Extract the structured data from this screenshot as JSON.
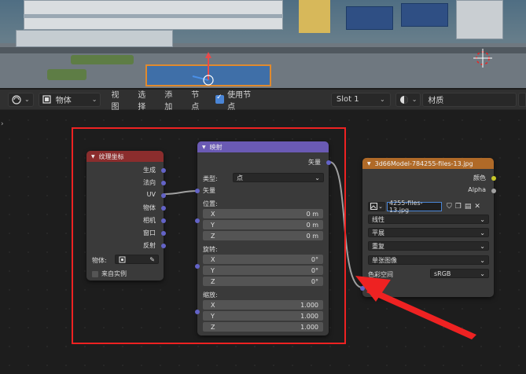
{
  "header": {
    "object_mode": "物体",
    "menus": [
      "视图",
      "选择",
      "添加",
      "节点"
    ],
    "use_nodes_label": "使用节点",
    "slot": "Slot 1",
    "material_name": "材质"
  },
  "texcoord_node": {
    "title": "纹理坐标",
    "outputs": [
      "生成",
      "法向",
      "UV",
      "物体",
      "相机",
      "窗口",
      "反射"
    ],
    "object_label": "物体:",
    "from_instancer": "来自实例"
  },
  "mapping_node": {
    "title": "映射",
    "output": "矢量",
    "type_label": "类型:",
    "type_value": "点",
    "vector_input": "矢量",
    "location": {
      "label": "位置:",
      "x": "0 m",
      "y": "0 m",
      "z": "0 m"
    },
    "rotation": {
      "label": "旋转:",
      "x": "0°",
      "y": "0°",
      "z": "0°"
    },
    "scale": {
      "label": "缩放:",
      "x": "1.000",
      "y": "1.000",
      "z": "1.000"
    },
    "axis_x": "X",
    "axis_y": "Y",
    "axis_z": "Z"
  },
  "image_node": {
    "title": "3d66Model-784255-files-13.jpg",
    "outputs": [
      "颜色",
      "Alpha"
    ],
    "image_name": "4255-files-13.jpg",
    "interpolation": "线性",
    "projection": "平展",
    "extension": "重复",
    "source": "单张图像",
    "colorspace_label": "色彩空间",
    "colorspace_value": "sRGB",
    "vector_input": "矢量"
  },
  "colors": {
    "texcoord_header": "#8b2d2d",
    "mapping_header": "#6a5ab4",
    "image_header": "#b06a28",
    "highlight_box": "#e22222",
    "vector_socket": "#6363c7",
    "color_socket": "#c7c729"
  }
}
